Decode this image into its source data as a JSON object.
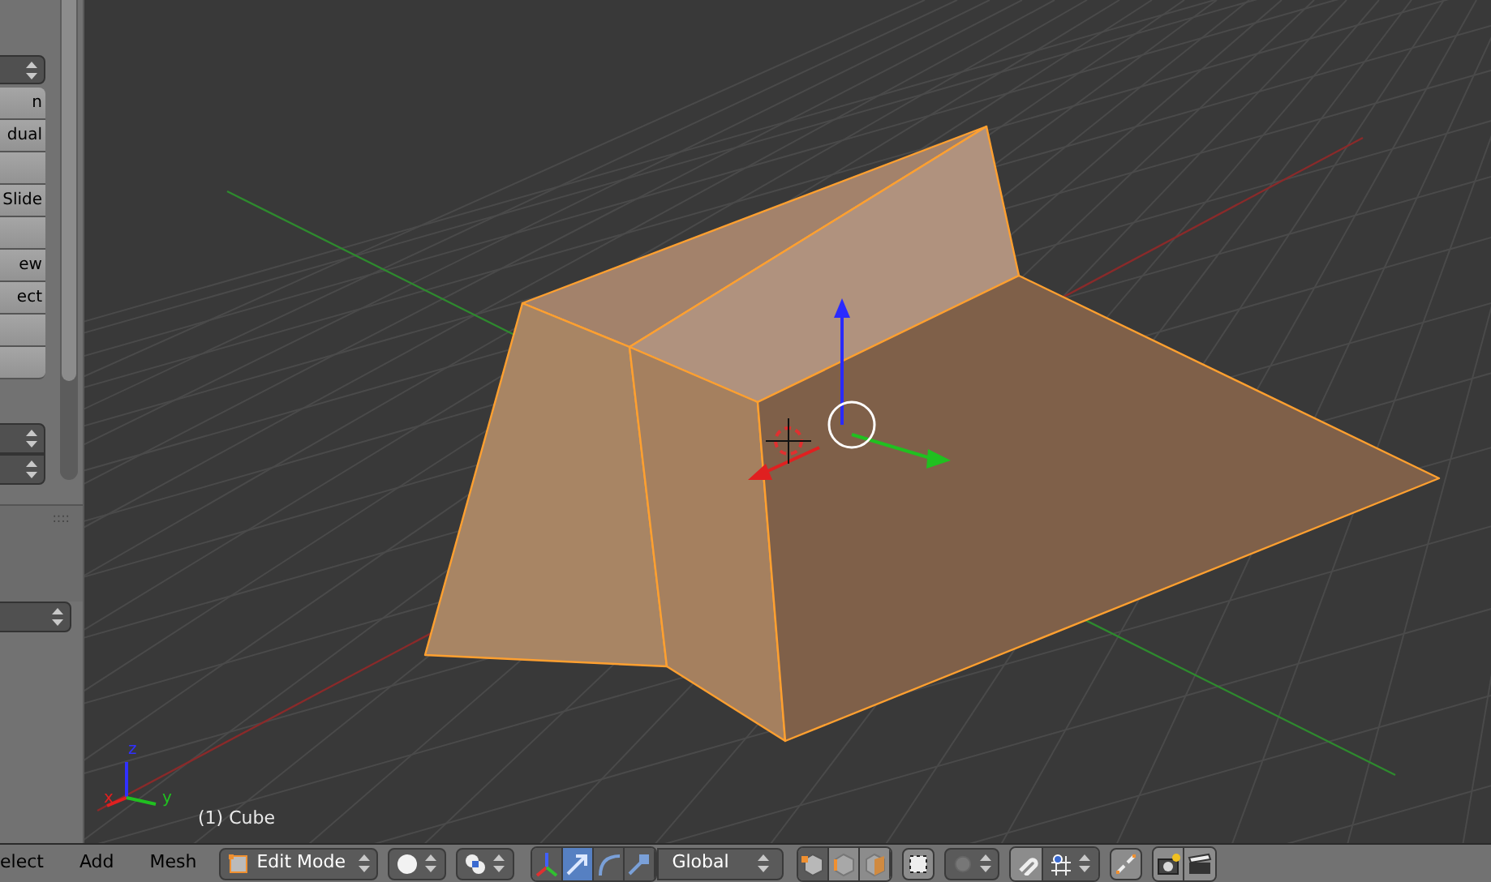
{
  "tool_panel": {
    "buttons": [
      {
        "kind": "text",
        "label": "n"
      },
      {
        "kind": "text",
        "label": "dual"
      },
      {
        "kind": "blank"
      },
      {
        "kind": "text",
        "label": "Slide"
      },
      {
        "kind": "blank"
      },
      {
        "kind": "text",
        "label": "ew"
      },
      {
        "kind": "text",
        "label": "ect"
      },
      {
        "kind": "blank"
      },
      {
        "kind": "blank"
      }
    ],
    "grip": "::::"
  },
  "viewport": {
    "axis_labels": [
      "z",
      "x",
      "y"
    ],
    "object_info": "(1) Cube"
  },
  "header": {
    "menus": [
      "elect",
      "Add",
      "Mesh"
    ],
    "mode": "Edit Mode",
    "orientation": "Global",
    "manipulators": [
      {
        "kind": "axes",
        "selected": false
      },
      {
        "kind": "translate",
        "selected": true
      },
      {
        "kind": "rotate",
        "selected": false
      },
      {
        "kind": "scale",
        "selected": false
      }
    ],
    "select_modes": [
      {
        "kind": "vertex",
        "selected": true
      },
      {
        "kind": "edge",
        "selected": false
      },
      {
        "kind": "face",
        "selected": false
      }
    ]
  }
}
